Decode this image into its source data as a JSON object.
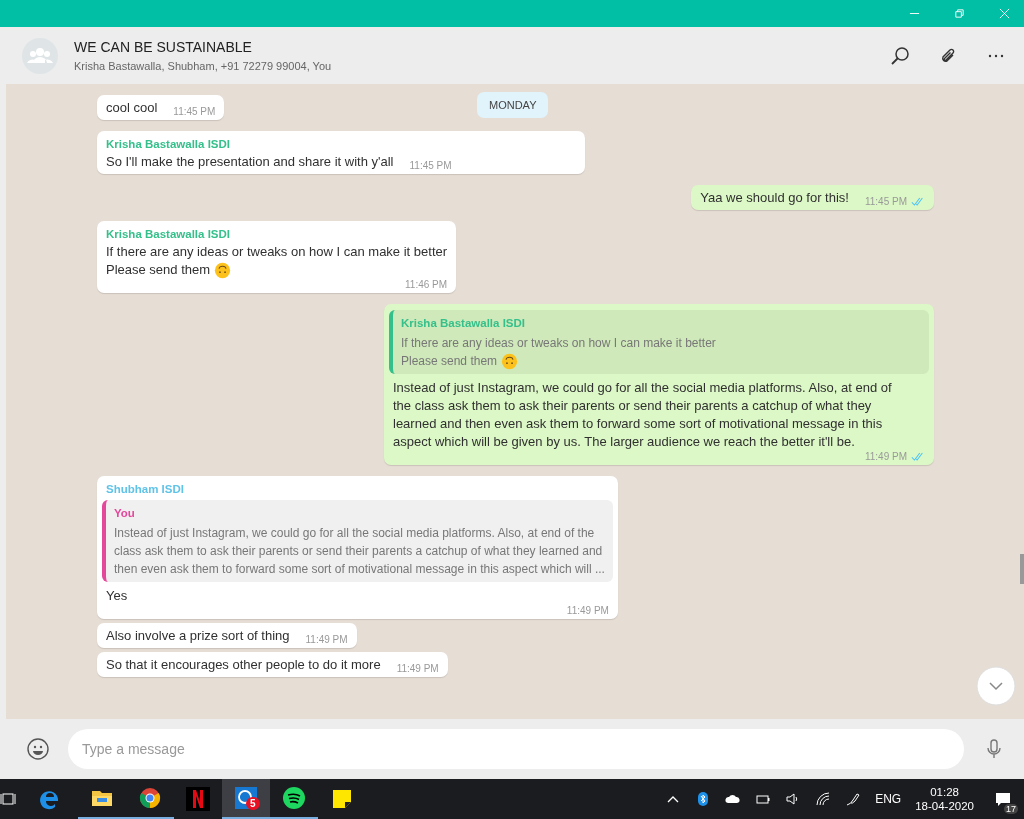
{
  "header": {
    "title": "WE CAN BE SUSTAINABLE",
    "participants": "Krisha Bastawalla, Shubham, +91 72279 99004, You"
  },
  "date_chip": "MONDAY",
  "messages": [
    {
      "kind": "incoming",
      "lines": [
        "cool cool"
      ],
      "time": "11:45 PM"
    },
    {
      "kind": "incoming",
      "sender": "Krisha Bastawalla ISDI",
      "color": "#35c08b",
      "lines": [
        "So I'll make the presentation and share it with y'all"
      ],
      "time": "11:45 PM"
    },
    {
      "kind": "outgoing",
      "lines": [
        "Yaa we should go for this!"
      ],
      "time": "11:45 PM",
      "read": true
    },
    {
      "kind": "incoming",
      "sender": "Krisha Bastawalla ISDI",
      "color": "#35c08b",
      "lines": [
        "If there are any ideas or tweaks on how I can make it better",
        "Please send them"
      ],
      "emoji": true,
      "time": "11:46 PM"
    },
    {
      "kind": "outgoing",
      "quote": {
        "author": "Krisha Bastawalla ISDI",
        "color": "#35c08b",
        "lines": [
          "If there are any ideas or tweaks on how I can make it better",
          "Please send them"
        ],
        "emoji": true
      },
      "lines": [
        "Instead of just Instagram, we could go for all the social media platforms. Also, at end of the class ask them to ask their parents or send their parents a catchup of what they learned and then even ask them to forward some sort of motivational message in this aspect which will be given by us. The larger audience we reach the better it'll be."
      ],
      "time": "11:49 PM",
      "read": true
    },
    {
      "kind": "incoming",
      "sender": "Shubham ISDI",
      "color": "#5fc3e8",
      "quote": {
        "author": "You",
        "color": "#e3489b",
        "lines": [
          "Instead of just Instagram, we could go for all the social media platforms. Also, at end of the",
          "class ask them to ask their parents or send their parents a catchup of what they learned and",
          "then even ask them to forward some sort of motivational message in this aspect which will ..."
        ]
      },
      "lines": [
        "Yes"
      ],
      "time": "11:49 PM"
    },
    {
      "kind": "incoming",
      "lines": [
        "Also involve a prize sort of thing"
      ],
      "time": "11:49 PM"
    },
    {
      "kind": "incoming",
      "lines": [
        "So that it encourages other people to do it more"
      ],
      "time": "11:49 PM"
    }
  ],
  "composer": {
    "placeholder": "Type a message"
  },
  "taskbar": {
    "apps": [
      {
        "kind": "explorer",
        "running": true,
        "selected": false
      },
      {
        "kind": "chrome",
        "running": true,
        "selected": false
      },
      {
        "kind": "netflix",
        "running": false,
        "selected": false
      },
      {
        "kind": "whatsapp",
        "running": true,
        "selected": true,
        "badge": "5"
      },
      {
        "kind": "spotify",
        "running": true,
        "selected": false
      },
      {
        "kind": "sticky",
        "running": false,
        "selected": false
      }
    ],
    "language": "ENG",
    "time": "01:28",
    "date": "18-04-2020",
    "notifications": "17"
  }
}
